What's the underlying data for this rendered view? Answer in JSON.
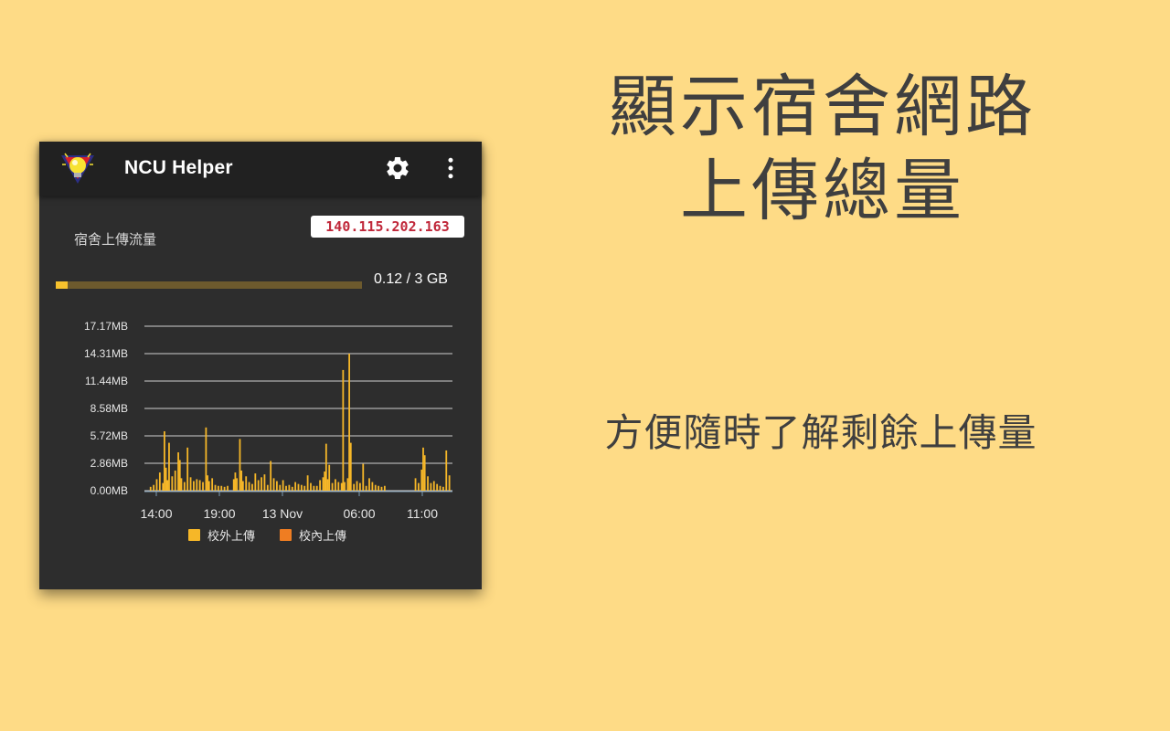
{
  "app": {
    "title": "NCU Helper",
    "logo_icon": "lightbulb-logo-icon",
    "settings_icon": "gear-icon",
    "menu_icon": "more-vert-icon"
  },
  "ip_address": "140.115.202.163",
  "usage": {
    "label": "宿舍上傳流量",
    "text": "0.12 / 3 GB",
    "used_gb": 0.12,
    "total_gb": 3,
    "fraction": 0.04,
    "fill_color": "#f6c12d",
    "track_color": "#6d5a2d"
  },
  "chart_data": {
    "type": "bar",
    "y_ticks": [
      "17.17MB",
      "14.31MB",
      "11.44MB",
      "8.58MB",
      "5.72MB",
      "2.86MB",
      "0.00MB"
    ],
    "x_ticks": [
      "14:00",
      "19:00",
      "13 Nov",
      "06:00",
      "11:00"
    ],
    "ylim": [
      0,
      17.17
    ],
    "grid": true,
    "series": [
      {
        "name": "校外上傳",
        "color": "#f6b728",
        "values": [
          {
            "t": 0.02,
            "v": 0.4
          },
          {
            "t": 0.03,
            "v": 0.6
          },
          {
            "t": 0.04,
            "v": 1.2
          },
          {
            "t": 0.05,
            "v": 1.9
          },
          {
            "t": 0.06,
            "v": 0.8
          },
          {
            "t": 0.065,
            "v": 6.2
          },
          {
            "t": 0.07,
            "v": 2.4
          },
          {
            "t": 0.075,
            "v": 1.1
          },
          {
            "t": 0.08,
            "v": 5.0
          },
          {
            "t": 0.09,
            "v": 1.5
          },
          {
            "t": 0.1,
            "v": 2.1
          },
          {
            "t": 0.11,
            "v": 4.0
          },
          {
            "t": 0.115,
            "v": 3.2
          },
          {
            "t": 0.12,
            "v": 1.3
          },
          {
            "t": 0.13,
            "v": 0.9
          },
          {
            "t": 0.14,
            "v": 4.5
          },
          {
            "t": 0.15,
            "v": 1.4
          },
          {
            "t": 0.16,
            "v": 1.0
          },
          {
            "t": 0.17,
            "v": 1.2
          },
          {
            "t": 0.18,
            "v": 1.1
          },
          {
            "t": 0.19,
            "v": 0.9
          },
          {
            "t": 0.2,
            "v": 6.6
          },
          {
            "t": 0.205,
            "v": 1.6
          },
          {
            "t": 0.21,
            "v": 1.0
          },
          {
            "t": 0.22,
            "v": 1.3
          },
          {
            "t": 0.23,
            "v": 0.6
          },
          {
            "t": 0.24,
            "v": 0.5
          },
          {
            "t": 0.25,
            "v": 0.5
          },
          {
            "t": 0.26,
            "v": 0.4
          },
          {
            "t": 0.27,
            "v": 0.5
          },
          {
            "t": 0.29,
            "v": 1.2
          },
          {
            "t": 0.295,
            "v": 1.9
          },
          {
            "t": 0.3,
            "v": 1.3
          },
          {
            "t": 0.31,
            "v": 5.4
          },
          {
            "t": 0.315,
            "v": 2.1
          },
          {
            "t": 0.32,
            "v": 1.0
          },
          {
            "t": 0.33,
            "v": 1.5
          },
          {
            "t": 0.34,
            "v": 0.9
          },
          {
            "t": 0.35,
            "v": 0.7
          },
          {
            "t": 0.36,
            "v": 1.8
          },
          {
            "t": 0.37,
            "v": 1.1
          },
          {
            "t": 0.38,
            "v": 1.4
          },
          {
            "t": 0.39,
            "v": 1.7
          },
          {
            "t": 0.4,
            "v": 0.6
          },
          {
            "t": 0.41,
            "v": 3.1
          },
          {
            "t": 0.42,
            "v": 1.3
          },
          {
            "t": 0.43,
            "v": 1.0
          },
          {
            "t": 0.44,
            "v": 0.6
          },
          {
            "t": 0.45,
            "v": 1.1
          },
          {
            "t": 0.46,
            "v": 0.5
          },
          {
            "t": 0.47,
            "v": 0.6
          },
          {
            "t": 0.48,
            "v": 0.4
          },
          {
            "t": 0.49,
            "v": 0.9
          },
          {
            "t": 0.5,
            "v": 0.7
          },
          {
            "t": 0.51,
            "v": 0.6
          },
          {
            "t": 0.52,
            "v": 0.5
          },
          {
            "t": 0.53,
            "v": 1.6
          },
          {
            "t": 0.54,
            "v": 0.8
          },
          {
            "t": 0.55,
            "v": 0.5
          },
          {
            "t": 0.56,
            "v": 0.5
          },
          {
            "t": 0.57,
            "v": 1.1
          },
          {
            "t": 0.58,
            "v": 1.4
          },
          {
            "t": 0.585,
            "v": 2.0
          },
          {
            "t": 0.59,
            "v": 4.9
          },
          {
            "t": 0.595,
            "v": 1.2
          },
          {
            "t": 0.6,
            "v": 2.7
          },
          {
            "t": 0.61,
            "v": 0.8
          },
          {
            "t": 0.62,
            "v": 1.2
          },
          {
            "t": 0.63,
            "v": 0.9
          },
          {
            "t": 0.64,
            "v": 0.8
          },
          {
            "t": 0.645,
            "v": 12.6
          },
          {
            "t": 0.65,
            "v": 0.9
          },
          {
            "t": 0.66,
            "v": 1.3
          },
          {
            "t": 0.665,
            "v": 14.3
          },
          {
            "t": 0.67,
            "v": 5.0
          },
          {
            "t": 0.68,
            "v": 0.7
          },
          {
            "t": 0.69,
            "v": 1.0
          },
          {
            "t": 0.7,
            "v": 0.8
          },
          {
            "t": 0.71,
            "v": 2.8
          },
          {
            "t": 0.72,
            "v": 0.5
          },
          {
            "t": 0.73,
            "v": 1.3
          },
          {
            "t": 0.74,
            "v": 0.9
          },
          {
            "t": 0.75,
            "v": 0.6
          },
          {
            "t": 0.76,
            "v": 0.5
          },
          {
            "t": 0.77,
            "v": 0.4
          },
          {
            "t": 0.78,
            "v": 0.5
          },
          {
            "t": 0.88,
            "v": 1.3
          },
          {
            "t": 0.89,
            "v": 0.8
          },
          {
            "t": 0.9,
            "v": 2.2
          },
          {
            "t": 0.905,
            "v": 4.5
          },
          {
            "t": 0.91,
            "v": 3.7
          },
          {
            "t": 0.92,
            "v": 1.5
          },
          {
            "t": 0.93,
            "v": 0.8
          },
          {
            "t": 0.94,
            "v": 1.0
          },
          {
            "t": 0.95,
            "v": 0.7
          },
          {
            "t": 0.96,
            "v": 0.5
          },
          {
            "t": 0.97,
            "v": 0.4
          },
          {
            "t": 0.98,
            "v": 4.2
          },
          {
            "t": 0.99,
            "v": 1.6
          }
        ]
      },
      {
        "name": "校內上傳",
        "color": "#ef7d22",
        "values": []
      }
    ]
  },
  "heading_line1": "顯示宿舍網路",
  "heading_line2": "上傳總量",
  "subheading": "方便隨時了解剩餘上傳量"
}
